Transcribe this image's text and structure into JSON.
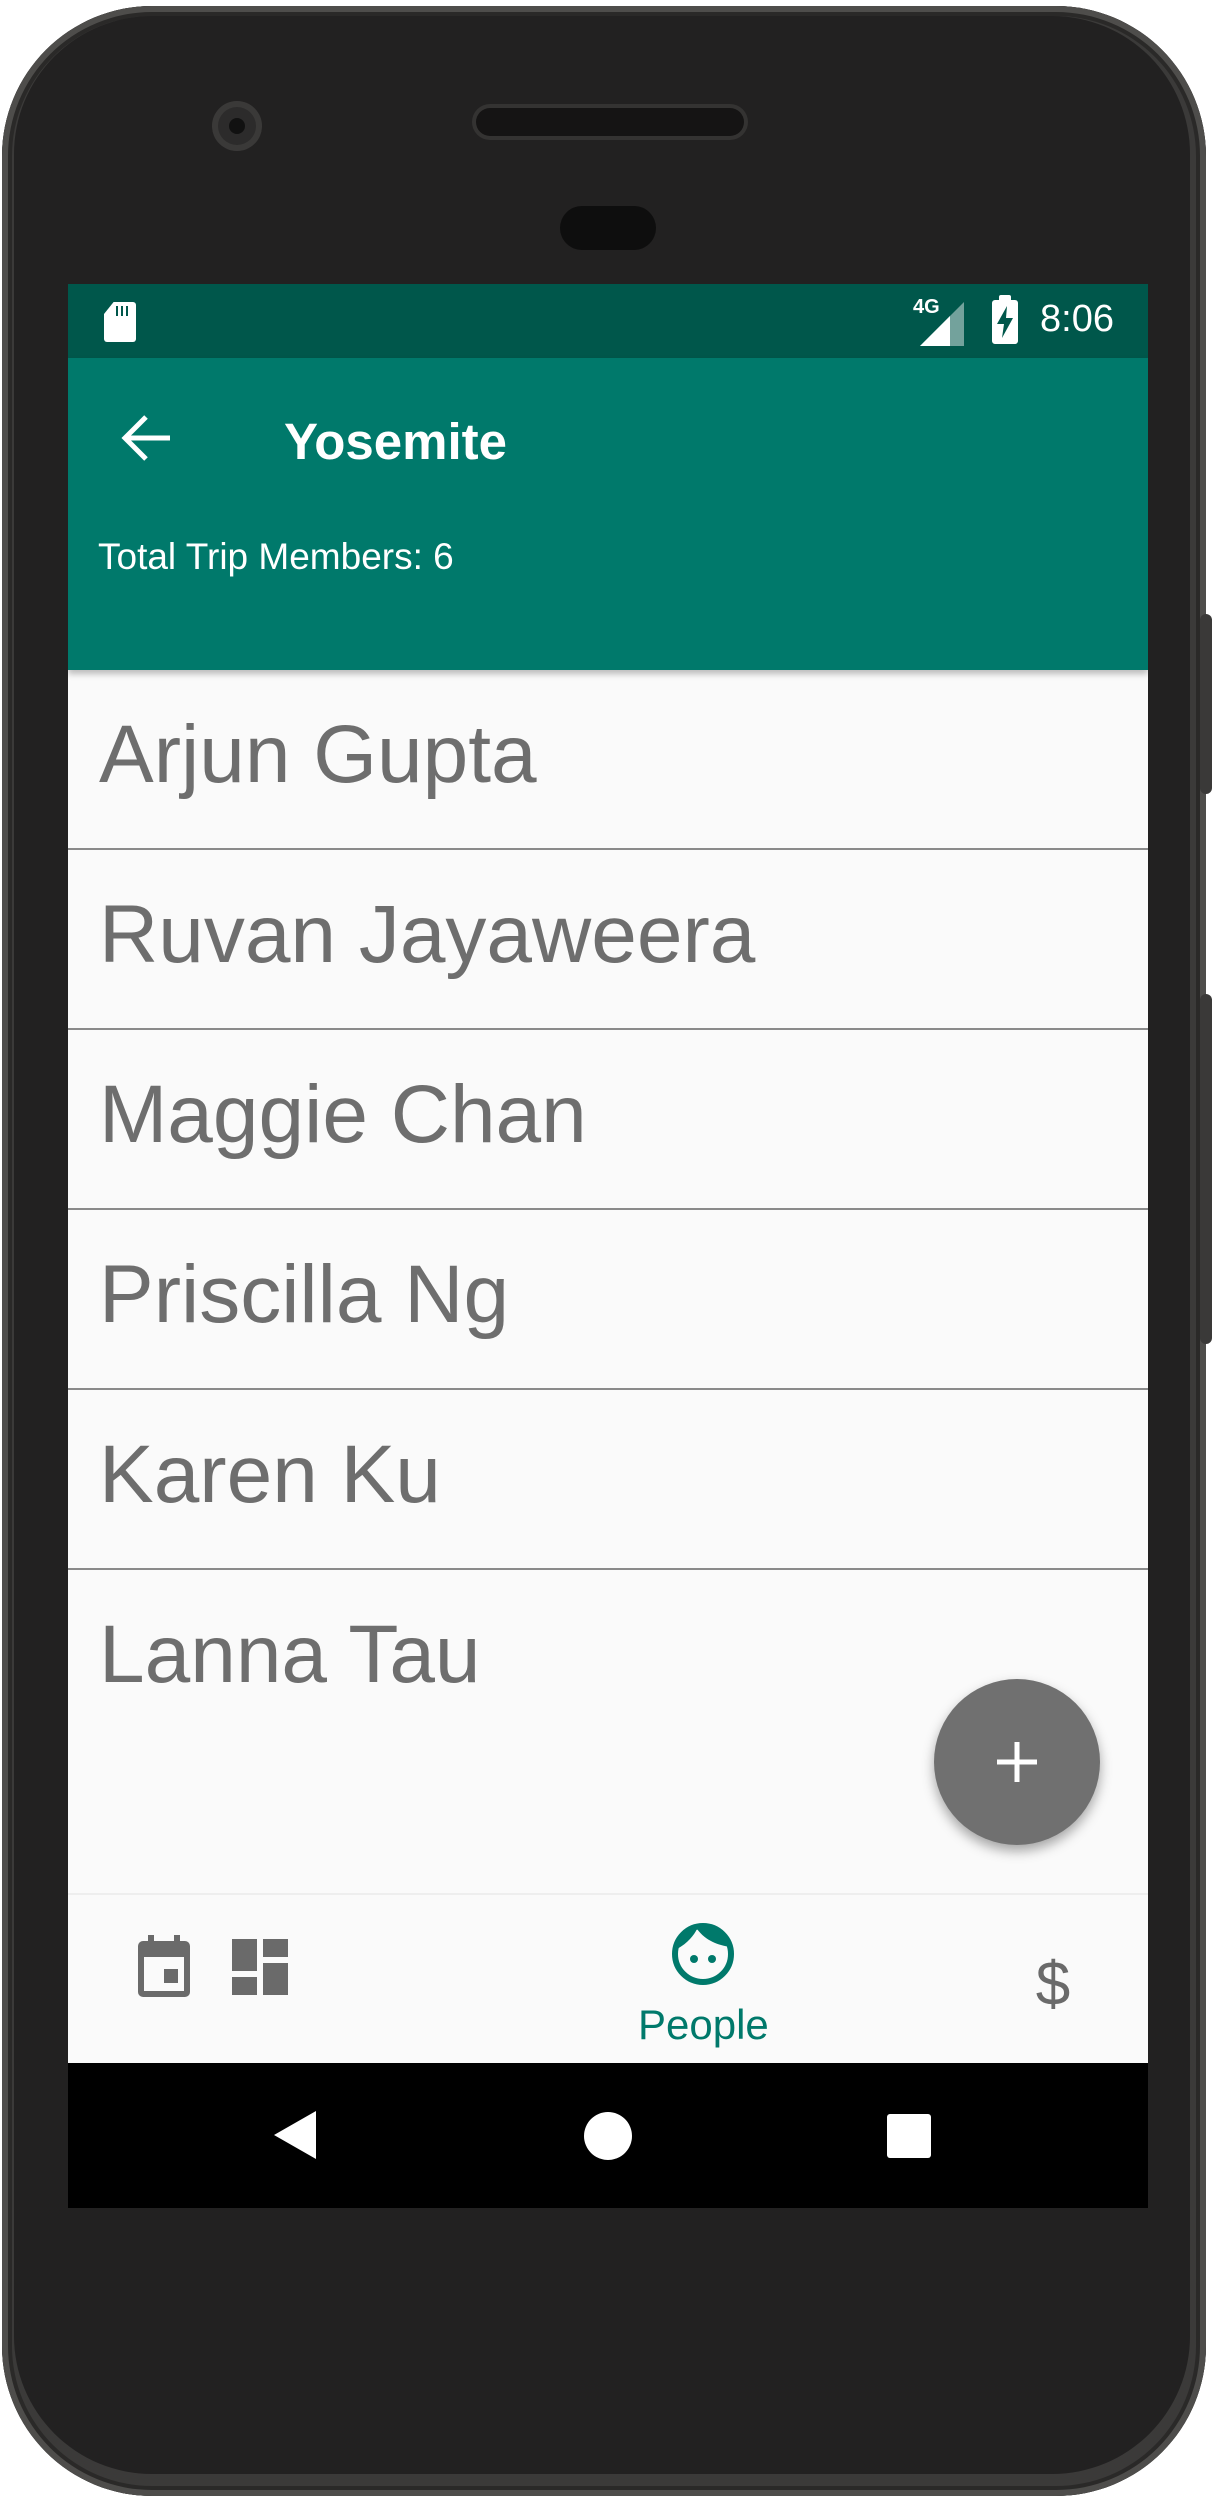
{
  "status_bar": {
    "network": "4G",
    "time": "8:06"
  },
  "app_bar": {
    "title": "Yosemite",
    "subtitle": "Total Trip Members: 6"
  },
  "members": [
    "Arjun Gupta",
    "Ruvan Jayaweera",
    "Maggie Chan",
    "Priscilla Ng",
    "Karen Ku",
    "Lanna Tau"
  ],
  "bottom_nav": {
    "items": [
      {
        "name": "calendar-icon",
        "label": ""
      },
      {
        "name": "dashboard-icon",
        "label": ""
      },
      {
        "name": "people-icon",
        "label": "People",
        "active": true
      },
      {
        "name": "dollar-icon",
        "label": "$"
      }
    ]
  },
  "colors": {
    "primary": "#00796b",
    "primary_dark": "#00574b",
    "fab": "#707070",
    "list_text": "#6e6e6e"
  },
  "system_nav": [
    "back-icon",
    "home-icon",
    "recents-icon"
  ]
}
